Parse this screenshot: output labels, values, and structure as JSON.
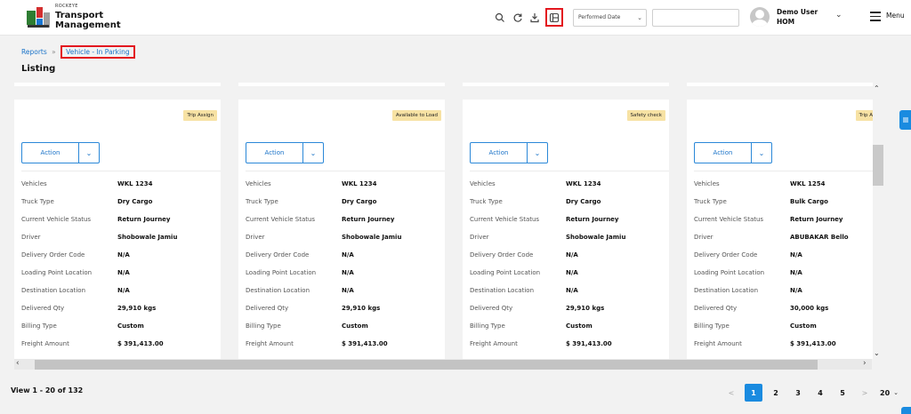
{
  "brand": {
    "company": "ROCKEYE",
    "product_line1": "Transport",
    "product_line2": "Management"
  },
  "header": {
    "icons": [
      "search-icon",
      "refresh-icon",
      "download-icon",
      "layout-icon"
    ],
    "date_filter": {
      "selected": "Performed Date"
    },
    "search_value": "",
    "user_name": "Demo User",
    "user_role": "HOM",
    "menu_label": "Menu"
  },
  "breadcrumb": {
    "root": "Reports",
    "separator": "»",
    "current": "Vehicle - In Parking"
  },
  "page_title": "Listing",
  "cards": [
    {
      "status": "Trip Assign",
      "action_label": "Action",
      "fields": [
        {
          "label": "Vehicles",
          "value": "WKL 1234"
        },
        {
          "label": "Truck Type",
          "value": "Dry Cargo"
        },
        {
          "label": "Current Vehicle Status",
          "value": "Return Journey"
        },
        {
          "label": "Driver",
          "value": "Shobowale Jamiu"
        },
        {
          "label": "Delivery Order Code",
          "value": "N/A"
        },
        {
          "label": "Loading Point Location",
          "value": "N/A"
        },
        {
          "label": "Destination Location",
          "value": "N/A"
        },
        {
          "label": "Delivered Qty",
          "value": "29,910 kgs"
        },
        {
          "label": "Billing Type",
          "value": "Custom"
        },
        {
          "label": "Freight Amount",
          "value": "$ 391,413.00"
        }
      ]
    },
    {
      "status": "Available to Load",
      "action_label": "Action",
      "fields": [
        {
          "label": "Vehicles",
          "value": "WKL 1234"
        },
        {
          "label": "Truck Type",
          "value": "Dry Cargo"
        },
        {
          "label": "Current Vehicle Status",
          "value": "Return Journey"
        },
        {
          "label": "Driver",
          "value": "Shobowale Jamiu"
        },
        {
          "label": "Delivery Order Code",
          "value": "N/A"
        },
        {
          "label": "Loading Point Location",
          "value": "N/A"
        },
        {
          "label": "Destination Location",
          "value": "N/A"
        },
        {
          "label": "Delivered Qty",
          "value": "29,910 kgs"
        },
        {
          "label": "Billing Type",
          "value": "Custom"
        },
        {
          "label": "Freight Amount",
          "value": "$ 391,413.00"
        }
      ]
    },
    {
      "status": "Safety check",
      "action_label": "Action",
      "fields": [
        {
          "label": "Vehicles",
          "value": "WKL 1234"
        },
        {
          "label": "Truck Type",
          "value": "Dry Cargo"
        },
        {
          "label": "Current Vehicle Status",
          "value": "Return Journey"
        },
        {
          "label": "Driver",
          "value": "Shobowale Jamiu"
        },
        {
          "label": "Delivery Order Code",
          "value": "N/A"
        },
        {
          "label": "Loading Point Location",
          "value": "N/A"
        },
        {
          "label": "Destination Location",
          "value": "N/A"
        },
        {
          "label": "Delivered Qty",
          "value": "29,910 kgs"
        },
        {
          "label": "Billing Type",
          "value": "Custom"
        },
        {
          "label": "Freight Amount",
          "value": "$ 391,413.00"
        }
      ]
    },
    {
      "status": "Trip A",
      "action_label": "Action",
      "fields": [
        {
          "label": "Vehicles",
          "value": "WKL 1254"
        },
        {
          "label": "Truck Type",
          "value": "Bulk Cargo"
        },
        {
          "label": "Current Vehicle Status",
          "value": "Return Journey"
        },
        {
          "label": "Driver",
          "value": "ABUBAKAR Bello"
        },
        {
          "label": "Delivery Order Code",
          "value": "N/A"
        },
        {
          "label": "Loading Point Location",
          "value": "N/A"
        },
        {
          "label": "Destination Location",
          "value": "N/A"
        },
        {
          "label": "Delivered Qty",
          "value": "30,000 kgs"
        },
        {
          "label": "Billing Type",
          "value": "Custom"
        },
        {
          "label": "Freight Amount",
          "value": "$ 391,413.00"
        }
      ]
    }
  ],
  "footer": {
    "view_info": "View 1 - 20 of 132",
    "pages": [
      "1",
      "2",
      "3",
      "4",
      "5"
    ],
    "current_page": "1",
    "prev": "<",
    "next": ">",
    "per_page": "20"
  },
  "colors": {
    "accent": "#1a8be0",
    "highlight_box": "#e3171f",
    "badge_bg": "#f7e2a4"
  }
}
